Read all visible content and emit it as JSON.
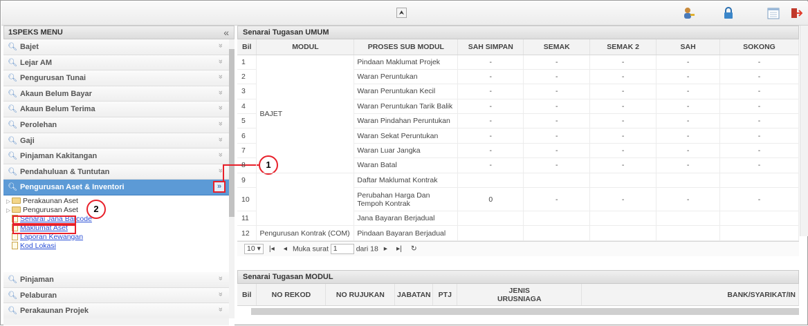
{
  "topbar": {
    "collapse_glyph": "⮝"
  },
  "sidebar": {
    "title": "1SPEKS MENU",
    "collapse_glyph": "«",
    "items_top": [
      {
        "label": "Bajet"
      },
      {
        "label": "Lejar AM"
      },
      {
        "label": "Pengurusan Tunai"
      },
      {
        "label": "Akaun Belum Bayar"
      },
      {
        "label": "Akaun Belum Terima"
      },
      {
        "label": "Perolehan"
      },
      {
        "label": "Gaji"
      },
      {
        "label": "Pinjaman Kakitangan"
      },
      {
        "label": "Pendahuluan & Tuntutan"
      }
    ],
    "active_item": "Pengurusan Aset & Inventori",
    "tree": {
      "folder1": "Perakaunan Aset",
      "folder2": "Pengurusan Aset",
      "leaf1": "Senarai Jana Barcode",
      "leaf2": "Maklumat Aset",
      "leaf3": "Laporan Kewangan",
      "leaf4": "Kod Lokasi"
    },
    "items_bottom": [
      {
        "label": "Pinjaman"
      },
      {
        "label": "Pelaburan"
      },
      {
        "label": "Perakaunan Projek"
      }
    ]
  },
  "callouts": {
    "one": "1",
    "two": "2"
  },
  "umum": {
    "title": "Senarai Tugasan UMUM",
    "headers": {
      "bil": "Bil",
      "modul": "MODUL",
      "proses": "PROSES SUB MODUL",
      "sah_simpan": "SAH SIMPAN",
      "semak": "SEMAK",
      "semak2": "SEMAK 2",
      "sah": "SAH",
      "sokong": "SOKONG"
    },
    "modul_bajet": "BAJET",
    "modul_com": "Pengurusan Kontrak (COM)",
    "rows": [
      {
        "bil": "1",
        "proses": "Pindaan Maklumat Projek",
        "sah_simpan": "-",
        "semak": "-",
        "semak2": "-",
        "sah": "-",
        "sokong": "-"
      },
      {
        "bil": "2",
        "proses": "Waran Peruntukan",
        "sah_simpan": "-",
        "semak": "-",
        "semak2": "-",
        "sah": "-",
        "sokong": "-"
      },
      {
        "bil": "3",
        "proses": "Waran Peruntukan Kecil",
        "sah_simpan": "-",
        "semak": "-",
        "semak2": "-",
        "sah": "-",
        "sokong": "-"
      },
      {
        "bil": "4",
        "proses": "Waran Peruntukan Tarik Balik",
        "sah_simpan": "-",
        "semak": "-",
        "semak2": "-",
        "sah": "-",
        "sokong": "-"
      },
      {
        "bil": "5",
        "proses": "Waran Pindahan Peruntukan",
        "sah_simpan": "-",
        "semak": "-",
        "semak2": "-",
        "sah": "-",
        "sokong": "-"
      },
      {
        "bil": "6",
        "proses": "Waran Sekat Peruntukan",
        "sah_simpan": "-",
        "semak": "-",
        "semak2": "-",
        "sah": "-",
        "sokong": "-"
      },
      {
        "bil": "7",
        "proses": "Waran Luar Jangka",
        "sah_simpan": "-",
        "semak": "-",
        "semak2": "-",
        "sah": "-",
        "sokong": "-"
      },
      {
        "bil": "8",
        "proses": "Waran Batal",
        "sah_simpan": "-",
        "semak": "-",
        "semak2": "-",
        "sah": "-",
        "sokong": "-"
      },
      {
        "bil": "9",
        "proses": "Daftar Maklumat Kontrak",
        "sah_simpan": "",
        "semak": "",
        "semak2": "",
        "sah": "",
        "sokong": ""
      },
      {
        "bil": "10",
        "proses": "Perubahan Harga Dan Tempoh Kontrak",
        "sah_simpan": "0",
        "semak": "-",
        "semak2": "-",
        "sah": "-",
        "sokong": "-"
      },
      {
        "bil": "11",
        "proses": "Jana Bayaran Berjadual",
        "sah_simpan": "",
        "semak": "",
        "semak2": "",
        "sah": "",
        "sokong": ""
      },
      {
        "bil": "12",
        "proses": "Pindaan Bayaran Berjadual",
        "sah_simpan": "",
        "semak": "",
        "semak2": "",
        "sah": "",
        "sokong": ""
      }
    ],
    "pager": {
      "size": "10",
      "muka_label": "Muka surat",
      "page": "1",
      "dari_label": "dari 18"
    }
  },
  "modul": {
    "title": "Senarai Tugasan MODUL",
    "headers": {
      "bil": "Bil",
      "no_rekod": "NO REKOD",
      "no_rujukan": "NO RUJUKAN",
      "jabatan": "JABATAN",
      "ptj": "PTJ",
      "jenis1": "JENIS",
      "jenis2": "URUSNIAGA",
      "bank": "BANK/SYARIKAT/IN"
    }
  },
  "colors": {
    "accent": "#5c9ad6",
    "highlight": "#e8202a"
  },
  "icons": [
    "user-key-icon",
    "lock-icon",
    "calendar-icon",
    "logout-icon"
  ]
}
